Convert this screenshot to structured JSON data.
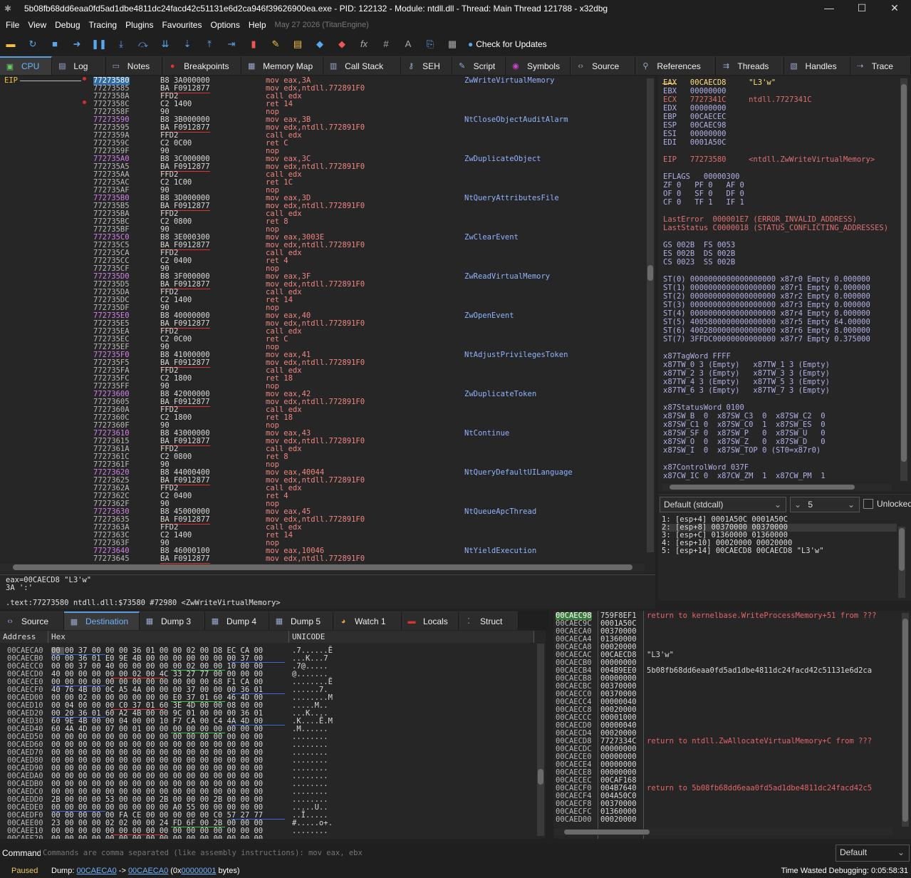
{
  "window": {
    "title": "5b08fb68dd6eaa0fd5ad1dbe4811dc24facd42c51131e6d2ca946f39626900ea.exe - PID: 122132 - Module: ntdll.dll - Thread: Main Thread 121788 - x32dbg",
    "minimize": "—",
    "maximize": "☐",
    "close": "✕"
  },
  "menu": {
    "items": [
      "File",
      "View",
      "Debug",
      "Tracing",
      "Plugins",
      "Favourites",
      "Options",
      "Help"
    ],
    "build": "May 27 2026 (TitanEngine)"
  },
  "toolbar": {
    "check_updates": "Check for Updates"
  },
  "top_tabs": [
    {
      "label": "CPU",
      "icon": "cpu-icon",
      "active": true
    },
    {
      "label": "Log",
      "icon": "log-icon"
    },
    {
      "label": "Notes",
      "icon": "notes-icon"
    },
    {
      "label": "Breakpoints",
      "icon": "breakpoint-icon"
    },
    {
      "label": "Memory Map",
      "icon": "memory-map-icon"
    },
    {
      "label": "Call Stack",
      "icon": "call-stack-icon"
    },
    {
      "label": "SEH",
      "icon": "seh-icon"
    },
    {
      "label": "Script",
      "icon": "script-icon"
    },
    {
      "label": "Symbols",
      "icon": "symbols-icon"
    },
    {
      "label": "Source",
      "icon": "source-icon"
    },
    {
      "label": "References",
      "icon": "references-icon"
    },
    {
      "label": "Threads",
      "icon": "threads-icon"
    },
    {
      "label": "Handles",
      "icon": "handles-icon"
    },
    {
      "label": "Trace",
      "icon": "trace-icon"
    }
  ],
  "disasm": {
    "eip_label": "EIP",
    "rows": [
      [
        "77273580",
        "B8 3A000000",
        "mov eax,3A",
        "ZwWriteVirtualMemory"
      ],
      [
        "77273585",
        "BA F0912877",
        "mov edx,ntdll.772891F0",
        ""
      ],
      [
        "7727358A",
        "FFD2",
        "call edx",
        ""
      ],
      [
        "7727358C",
        "C2 1400",
        "ret 14",
        ""
      ],
      [
        "7727358F",
        "90",
        "nop",
        ""
      ],
      [
        "77273590",
        "B8 3B000000",
        "mov eax,3B",
        "NtCloseObjectAuditAlarm"
      ],
      [
        "77273595",
        "BA F0912877",
        "mov edx,ntdll.772891F0",
        ""
      ],
      [
        "7727359A",
        "FFD2",
        "call edx",
        ""
      ],
      [
        "7727359C",
        "C2 0C00",
        "ret C",
        ""
      ],
      [
        "7727359F",
        "90",
        "nop",
        ""
      ],
      [
        "772735A0",
        "B8 3C000000",
        "mov eax,3C",
        "ZwDuplicateObject"
      ],
      [
        "772735A5",
        "BA F0912877",
        "mov edx,ntdll.772891F0",
        ""
      ],
      [
        "772735AA",
        "FFD2",
        "call edx",
        ""
      ],
      [
        "772735AC",
        "C2 1C00",
        "ret 1C",
        ""
      ],
      [
        "772735AF",
        "90",
        "nop",
        ""
      ],
      [
        "772735B0",
        "B8 3D000000",
        "mov eax,3D",
        "NtQueryAttributesFile"
      ],
      [
        "772735B5",
        "BA F0912877",
        "mov edx,ntdll.772891F0",
        ""
      ],
      [
        "772735BA",
        "FFD2",
        "call edx",
        ""
      ],
      [
        "772735BC",
        "C2 0800",
        "ret 8",
        ""
      ],
      [
        "772735BF",
        "90",
        "nop",
        ""
      ],
      [
        "772735C0",
        "B8 3E000300",
        "mov eax,3003E",
        "ZwClearEvent"
      ],
      [
        "772735C5",
        "BA F0912877",
        "mov edx,ntdll.772891F0",
        ""
      ],
      [
        "772735CA",
        "FFD2",
        "call edx",
        ""
      ],
      [
        "772735CC",
        "C2 0400",
        "ret 4",
        ""
      ],
      [
        "772735CF",
        "90",
        "nop",
        ""
      ],
      [
        "772735D0",
        "B8 3F000000",
        "mov eax,3F",
        "ZwReadVirtualMemory"
      ],
      [
        "772735D5",
        "BA F0912877",
        "mov edx,ntdll.772891F0",
        ""
      ],
      [
        "772735DA",
        "FFD2",
        "call edx",
        ""
      ],
      [
        "772735DC",
        "C2 1400",
        "ret 14",
        ""
      ],
      [
        "772735DF",
        "90",
        "nop",
        ""
      ],
      [
        "772735E0",
        "B8 40000000",
        "mov eax,40",
        "ZwOpenEvent"
      ],
      [
        "772735E5",
        "BA F0912877",
        "mov edx,ntdll.772891F0",
        ""
      ],
      [
        "772735EA",
        "FFD2",
        "call edx",
        ""
      ],
      [
        "772735EC",
        "C2 0C00",
        "ret C",
        ""
      ],
      [
        "772735EF",
        "90",
        "nop",
        ""
      ],
      [
        "772735F0",
        "B8 41000000",
        "mov eax,41",
        "NtAdjustPrivilegesToken"
      ],
      [
        "772735F5",
        "BA F0912877",
        "mov edx,ntdll.772891F0",
        ""
      ],
      [
        "772735FA",
        "FFD2",
        "call edx",
        ""
      ],
      [
        "772735FC",
        "C2 1800",
        "ret 18",
        ""
      ],
      [
        "772735FF",
        "90",
        "nop",
        ""
      ],
      [
        "77273600",
        "B8 42000000",
        "mov eax,42",
        "ZwDuplicateToken"
      ],
      [
        "77273605",
        "BA F0912877",
        "mov edx,ntdll.772891F0",
        ""
      ],
      [
        "7727360A",
        "FFD2",
        "call edx",
        ""
      ],
      [
        "7727360C",
        "C2 1800",
        "ret 18",
        ""
      ],
      [
        "7727360F",
        "90",
        "nop",
        ""
      ],
      [
        "77273610",
        "B8 43000000",
        "mov eax,43",
        "NtContinue"
      ],
      [
        "77273615",
        "BA F0912877",
        "mov edx,ntdll.772891F0",
        ""
      ],
      [
        "7727361A",
        "FFD2",
        "call edx",
        ""
      ],
      [
        "7727361C",
        "C2 0800",
        "ret 8",
        ""
      ],
      [
        "7727361F",
        "90",
        "nop",
        ""
      ],
      [
        "77273620",
        "B8 44000400",
        "mov eax,40044",
        "NtQueryDefaultUILanguage"
      ],
      [
        "77273625",
        "BA F0912877",
        "mov edx,ntdll.772891F0",
        ""
      ],
      [
        "7727362A",
        "FFD2",
        "call edx",
        ""
      ],
      [
        "7727362C",
        "C2 0400",
        "ret 4",
        ""
      ],
      [
        "7727362F",
        "90",
        "nop",
        ""
      ],
      [
        "77273630",
        "B8 45000000",
        "mov eax,45",
        "NtQueueApcThread"
      ],
      [
        "77273635",
        "BA F0912877",
        "mov edx,ntdll.772891F0",
        ""
      ],
      [
        "7727363A",
        "FFD2",
        "call edx",
        ""
      ],
      [
        "7727363C",
        "C2 1400",
        "ret 14",
        ""
      ],
      [
        "7727363F",
        "90",
        "nop",
        ""
      ],
      [
        "77273640",
        "B8 46000100",
        "mov eax,10046",
        "NtYieldExecution"
      ],
      [
        "77273645",
        "BA F0912877",
        "mov edx,ntdll.772891F0",
        ""
      ]
    ]
  },
  "info": {
    "line1": "eax=00CAECD8 \"L3'w\"",
    "line2": "3A ':'",
    "line3": ".text:77273580 ntdll.dll:$73580 #72980 <ZwWriteVirtualMemory>"
  },
  "registers": {
    "lines": [
      "EAX   00CAECD8     \"L3'w\"",
      "EBX   00000000",
      "ECX   7727341C     ntdll.7727341C",
      "EDX   00000000",
      "EBP   00CAECEC",
      "ESP   00CAEC98",
      "ESI   00000000",
      "EDI   0001A50C",
      "",
      "EIP   77273580     <ntdll.ZwWriteVirtualMemory>",
      "",
      "EFLAGS   00000300",
      "ZF 0   PF 0   AF 0",
      "OF 0   SF 0   DF 0",
      "CF 0   TF 1   IF 1",
      "",
      "LastError  000001E7 (ERROR_INVALID_ADDRESS)",
      "LastStatus C0000018 (STATUS_CONFLICTING_ADDRESSES)",
      "",
      "GS 002B  FS 0053",
      "ES 002B  DS 002B",
      "CS 0023  SS 002B",
      "",
      "ST(0) 0000000000000000000 x87r0 Empty 0.000000",
      "ST(1) 0000000000000000000 x87r1 Empty 0.000000",
      "ST(2) 0000000000000000000 x87r2 Empty 0.000000",
      "ST(3) 0000000000000000000 x87r3 Empty 0.000000",
      "ST(4) 0000000000000000000 x87r4 Empty 0.000000",
      "ST(5) 4005800000000000000 x87r5 Empty 64.00000",
      "ST(6) 4002800000000000000 x87r6 Empty 8.000000",
      "ST(7) 3FFDC00000000000000 x87r7 Empty 0.375000",
      "",
      "x87TagWord FFFF",
      "x87TW_0 3 (Empty)   x87TW_1 3 (Empty)",
      "x87TW_2 3 (Empty)   x87TW_3 3 (Empty)",
      "x87TW_4 3 (Empty)   x87TW_5 3 (Empty)",
      "x87TW_6 3 (Empty)   x87TW_7 3 (Empty)",
      "",
      "x87StatusWord 0100",
      "x87SW_B  0  x87SW_C3  0  x87SW_C2  0",
      "x87SW_C1 0  x87SW_C0  1  x87SW_ES  0",
      "x87SW_SF 0  x87SW_P   0  x87SW_U   0",
      "x87SW_O  0  x87SW_Z   0  x87SW_D   0",
      "x87SW_I  0  x87SW_TOP 0 (ST0=x87r0)",
      "",
      "x87ControlWord 037F",
      "x87CW_IC 0  x87CW_ZM  1  x87CW_PM  1"
    ]
  },
  "callconv": {
    "selected": "Default (stdcall)",
    "count": "5",
    "unlocked_label": "Unlocked",
    "args": [
      "1: [esp+4] 0001A50C 0001A50C",
      "2: [esp+8] 00370000 00370000",
      "3: [esp+C] 01360000 01360000",
      "4: [esp+10] 00020000 00020000",
      "5: [esp+14] 00CAECD8 00CAECD8 \"L3'w\""
    ]
  },
  "dump_tabs": [
    {
      "label": "Source",
      "icon": "source-icon"
    },
    {
      "label": "Destination",
      "icon": "dump-icon",
      "active": true
    },
    {
      "label": "Dump 3",
      "icon": "dump-icon"
    },
    {
      "label": "Dump 4",
      "icon": "dump-icon"
    },
    {
      "label": "Dump 5",
      "icon": "dump-icon"
    },
    {
      "label": "Watch 1",
      "icon": "watch-icon"
    },
    {
      "label": "Locals",
      "icon": "locals-icon"
    },
    {
      "label": "Struct",
      "icon": "struct-icon"
    }
  ],
  "dump": {
    "headers": [
      "Address",
      "Hex",
      "UNICODE"
    ],
    "rows": [
      [
        "00CAECA0",
        "00 00 37 00 00 00 36 01 00 00 02 00 D8 EC CA 00",
        ".7......Ē"
      ],
      [
        "00CAECB0",
        "00 00 36 01 E0 9E 4B 00 00 00 00 00 00 00 37 00",
        "...K...7"
      ],
      [
        "00CAECC0",
        "00 00 37 00 40 00 00 00 00 00 02 00 00 10 00 00",
        ".7@....."
      ],
      [
        "00CAECD0",
        "40 00 00 00 00 00 02 00 4C 33 27 77 00 00 00 00",
        "@......."
      ],
      [
        "00CAECE0",
        "00 00 00 00 00 00 00 00 00 00 00 00 68 F1 CA 00",
        "........Ē"
      ],
      [
        "00CAECF0",
        "40 76 4B 00 0C A5 4A 00 00 00 37 00 00 00 36 01",
        "......7."
      ],
      [
        "00CAED00",
        "00 00 02 00 00 00 00 00 00 E0 37 01 60 46 4D 00",
        "........M"
      ],
      [
        "00CAED10",
        "00 04 00 00 00 C0 37 01 60 3E 4D 00 00 08 00 00",
        ".....M.."
      ],
      [
        "00CAED20",
        "00 20 36 01 60 A2 4B 00 00 9C 01 00 00 00 36 01",
        "...K...."
      ],
      [
        "00CAED30",
        "60 9E 4B 00 00 04 00 00 10 F7 CA 00 C4 4A 4D 00",
        ".K....Ē.M"
      ],
      [
        "00CAED40",
        "60 4A 4D 00 07 00 01 00 00 00 00 00 00 00 00 00",
        ".M......"
      ],
      [
        "00CAED50",
        "00 00 00 00 00 00 00 00 00 00 00 00 00 00 00 00",
        "........"
      ],
      [
        "00CAED60",
        "00 00 00 00 00 00 00 00 00 00 00 00 00 00 00 00",
        "........"
      ],
      [
        "00CAED70",
        "00 00 00 00 00 00 00 00 00 00 00 00 00 00 00 00",
        "........"
      ],
      [
        "00CAED80",
        "00 00 00 00 00 00 00 00 00 00 00 00 00 00 00 00",
        "........"
      ],
      [
        "00CAED90",
        "00 00 00 00 00 00 00 00 00 00 00 00 00 00 00 00",
        "........"
      ],
      [
        "00CAEDA0",
        "00 00 00 00 00 00 00 00 00 00 00 00 00 00 00 00",
        "........"
      ],
      [
        "00CAEDB0",
        "00 00 00 00 00 00 00 00 00 00 00 00 00 00 00 00",
        "........"
      ],
      [
        "00CAEDC0",
        "00 00 00 00 00 00 00 00 00 00 00 00 00 00 00 00",
        "........"
      ],
      [
        "00CAEDD0",
        "2B 00 00 00 53 00 00 00 2B 00 00 00 2B 00 00 00",
        "........"
      ],
      [
        "00CAEDE0",
        "00 00 00 00 00 00 00 00 00 A0 55 00 00 00 00 00",
        ".....U.."
      ],
      [
        "00CAEDF0",
        "00 00 00 00 00 FA CE 00 00 00 00 00 C0 57 27 77",
        "..Ī....."
      ],
      [
        "00CAEE00",
        "23 00 00 00 02 02 00 00 24 FD 6F 00 2B 00 00 00",
        "#.....o+."
      ],
      [
        "00CAEE10",
        "00 00 00 00 00 00 00 00 00 00 00 00 00 00 00 00",
        "........"
      ],
      [
        "00CAEE20",
        "00 00 00 00 00 00 00 00 00 00 00 00 00 00 00 00",
        "........"
      ]
    ]
  },
  "stack": {
    "rows": [
      [
        "00CAEC98",
        "759F8EF1",
        "return to kernelbase.WriteProcessMemory+51 from ???",
        true
      ],
      [
        "00CAEC9C",
        "0001A50C",
        "",
        false
      ],
      [
        "00CAECA0",
        "00370000",
        "",
        false
      ],
      [
        "00CAECA4",
        "01360000",
        "",
        false
      ],
      [
        "00CAECA8",
        "00020000",
        "",
        false
      ],
      [
        "00CAECAC",
        "00CAECD8",
        "\"L3'w\"",
        false
      ],
      [
        "00CAECB0",
        "00000000",
        "",
        false
      ],
      [
        "00CAECB4",
        "004B9EE0",
        "5b08fb68dd6eaa0fd5ad1dbe4811dc24facd42c51131e6d2ca",
        false
      ],
      [
        "00CAECB8",
        "00000000",
        "",
        false
      ],
      [
        "00CAECBC",
        "00370000",
        "",
        false
      ],
      [
        "00CAECC0",
        "00370000",
        "",
        false
      ],
      [
        "00CAECC4",
        "00000040",
        "",
        false
      ],
      [
        "00CAECC8",
        "00020000",
        "",
        false
      ],
      [
        "00CAECCC",
        "00001000",
        "",
        false
      ],
      [
        "00CAECD0",
        "00000040",
        "",
        false
      ],
      [
        "00CAECD4",
        "00020000",
        "",
        false
      ],
      [
        "00CAECD8",
        "7727334C",
        "return to ntdll.ZwAllocateVirtualMemory+C from ???",
        true
      ],
      [
        "00CAECDC",
        "00000000",
        "",
        false
      ],
      [
        "00CAECE0",
        "00000000",
        "",
        false
      ],
      [
        "00CAECE4",
        "00000000",
        "",
        false
      ],
      [
        "00CAECE8",
        "00000000",
        "",
        false
      ],
      [
        "00CAECEC",
        "00CAF168",
        "",
        false
      ],
      [
        "00CAECF0",
        "004B7640",
        "return to 5b08fb68dd6eaa0fd5ad1dbe4811dc24facd42c5",
        true
      ],
      [
        "00CAECF4",
        "004A50C0",
        "",
        false
      ],
      [
        "00CAECF8",
        "00370000",
        "",
        false
      ],
      [
        "00CAECFC",
        "01360000",
        "",
        false
      ],
      [
        "00CAED00",
        "00020000",
        "",
        false
      ]
    ]
  },
  "command": {
    "label": "Command:",
    "placeholder": "Commands are comma separated (like assembly instructions): mov eax, ebx",
    "mode": "Default"
  },
  "status": {
    "state": "Paused",
    "dump_prefix": "Dump: ",
    "dump_from": "00CAECA0",
    "arrow": " -> ",
    "dump_to": "00CAECA0",
    "size_prefix": " (0x",
    "size": "00000001",
    "size_suffix": " bytes)",
    "time": "Time Wasted Debugging: 0:05:58:31"
  }
}
